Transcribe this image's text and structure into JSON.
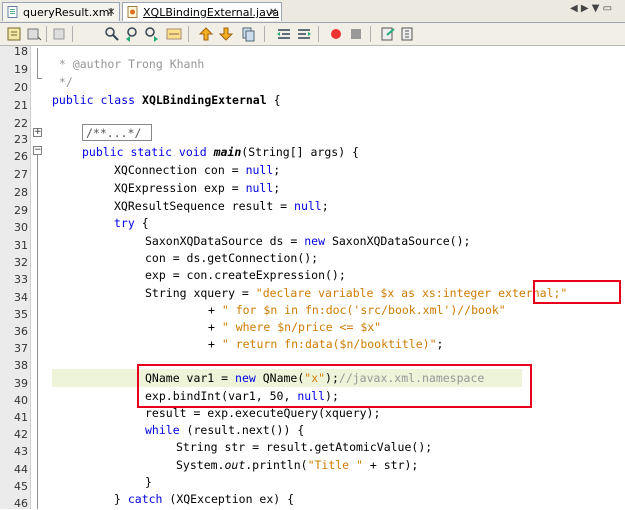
{
  "tabs": [
    {
      "label": "queryResult.xml",
      "active": false
    },
    {
      "label": "XQLBindingExternal.java",
      "active": true
    }
  ],
  "toolbar_icons": [
    "source-history-icon",
    "back-icon",
    "forward-icon",
    "find-icon",
    "find-prev-icon",
    "find-next-icon",
    "toggle-highlight-icon",
    "prev-bookmark-icon",
    "next-bookmark-icon",
    "toggle-bookmark-icon",
    "shift-left-icon",
    "shift-right-icon",
    "record-macro-icon",
    "stop-macro-icon",
    "comment-icon",
    "uncomment-icon"
  ],
  "line_numbers": [
    "18",
    "19",
    "20",
    "21",
    "22",
    "23",
    "26",
    "27",
    "28",
    "29",
    "30",
    "31",
    "32",
    "33",
    "34",
    "35",
    "36",
    "37",
    "38",
    "39",
    "40",
    "41",
    "42",
    "43",
    "44",
    "45",
    "46"
  ],
  "code": {
    "l19": " * @author Trong Khanh",
    "l20": " */",
    "l21_kw": "public class ",
    "l21_name": "XQLBindingExternal",
    "l21_rest": " {",
    "l23": "/**...*/",
    "l26_kw": "public static void ",
    "l26_name": "main",
    "l26_rest": "(String[] args) {",
    "l27_a": "XQConnection con = ",
    "l27_kw": "null",
    "l27_b": ";",
    "l28_a": "XQExpression exp = ",
    "l28_kw": "null",
    "l28_b": ";",
    "l29_a": "XQResultSequence result = ",
    "l29_kw": "null",
    "l29_b": ";",
    "l30_kw": "try",
    "l30_b": " {",
    "l31_a": "SaxonXQDataSource ds = ",
    "l31_kw": "new",
    "l31_b": " SaxonXQDataSource();",
    "l32": "con = ds.getConnection();",
    "l33": "exp = con.createExpression();",
    "l34_a": "String xquery = ",
    "l34_s": "\"declare variable $x as xs:integer external;\"",
    "l35_a": "+ ",
    "l35_s": "\" for $n in fn:doc('src/book.xml')//book\"",
    "l36_a": "+ ",
    "l36_s": "\" where $n/price <= $x\"",
    "l37_a": "+ ",
    "l37_s": "\" return fn:data($n/booktitle)\"",
    "l37_b": ";",
    "l39_a": "QName var1 = ",
    "l39_kw": "new",
    "l39_b": " QName(",
    "l39_s": "\"x\"",
    "l39_c": ");",
    "l39_cm": "//javax.xml.namespace",
    "l40_a": "exp.bindInt(var1, 50, ",
    "l40_kw": "null",
    "l40_b": ");",
    "l41": "result = exp.executeQuery(xquery);",
    "l42_kw": "while",
    "l42_b": " (result.next()) {",
    "l43": "String str = result.getAtomicValue();",
    "l44_a": "System.",
    "l44_it": "out",
    "l44_b": ".println(",
    "l44_s": "\"Title \"",
    "l44_c": " + str);",
    "l45": "}",
    "l46_a": "} ",
    "l46_kw": "catch",
    "l46_b": " (XQException ex) {"
  },
  "colors": {
    "keyword": "#0000e6",
    "string": "#ce7b00",
    "comment": "#969696",
    "annotation_box": "#e8001c"
  }
}
